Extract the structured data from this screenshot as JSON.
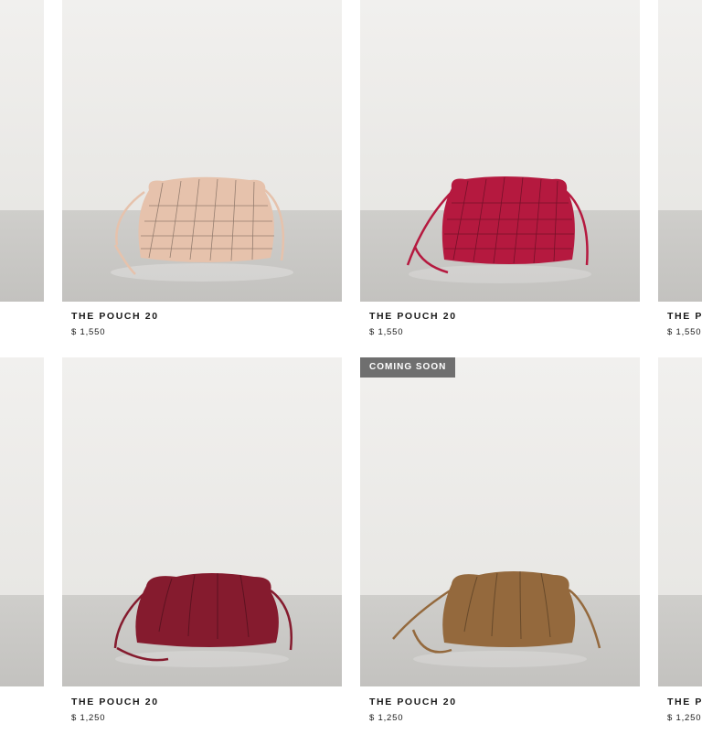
{
  "products": [
    {
      "name": "THE POUCH 20",
      "price": "$ 1,550",
      "color": "#e6c2ac",
      "style": "woven"
    },
    {
      "name": "THE POUCH 20",
      "price": "$ 1,550",
      "color": "#b5193f",
      "style": "woven"
    },
    {
      "name": "THE POUCH 20",
      "price": "$ 1,250",
      "color": "#851b2e",
      "style": "smooth"
    },
    {
      "name": "THE POUCH 20",
      "price": "$ 1,250",
      "color": "#94693d",
      "style": "smooth",
      "badge": "COMING SOON"
    }
  ],
  "partial": {
    "right_top": {
      "name": "THE P",
      "price": "$ 1,550"
    },
    "right_bottom": {
      "name": "THE P",
      "price": "$ 1,250"
    }
  }
}
